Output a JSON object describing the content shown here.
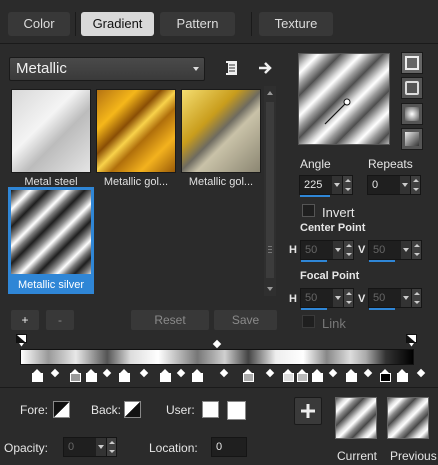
{
  "tabs": [
    {
      "label": "Color",
      "active": false
    },
    {
      "label": "Gradient",
      "active": true
    },
    {
      "label": "Pattern",
      "active": false
    },
    {
      "label": "Texture",
      "active": false
    }
  ],
  "category": {
    "selected": "Metallic"
  },
  "gradients": [
    {
      "label": "Metal steel",
      "selected": false
    },
    {
      "label": "Metallic gol...",
      "selected": false
    },
    {
      "label": "Metallic gol...",
      "selected": false
    },
    {
      "label": "Metallic silver",
      "selected": true
    }
  ],
  "list_buttons": {
    "add": "+",
    "remove": "-",
    "reset": "Reset",
    "save": "Save"
  },
  "angle": {
    "label": "Angle",
    "value": "225"
  },
  "repeats": {
    "label": "Repeats",
    "value": "0"
  },
  "invert": {
    "label": "Invert",
    "checked": false
  },
  "center_point": {
    "label": "Center Point",
    "h_label": "H",
    "h_value": "50",
    "v_label": "V",
    "v_value": "50"
  },
  "focal_point": {
    "label": "Focal Point",
    "h_label": "H",
    "h_value": "50",
    "v_label": "V",
    "v_value": "50"
  },
  "link": {
    "label": "Link",
    "checked": false
  },
  "fore": {
    "label": "Fore:"
  },
  "back": {
    "label": "Back:"
  },
  "user": {
    "label": "User:"
  },
  "opacity": {
    "label": "Opacity:",
    "value": "0"
  },
  "location": {
    "label": "Location:",
    "value": "0"
  },
  "current": {
    "label": "Current"
  },
  "previous": {
    "label": "Previous"
  },
  "colors": {
    "accent": "#2f86d6",
    "panel": "#2b2b2b"
  }
}
